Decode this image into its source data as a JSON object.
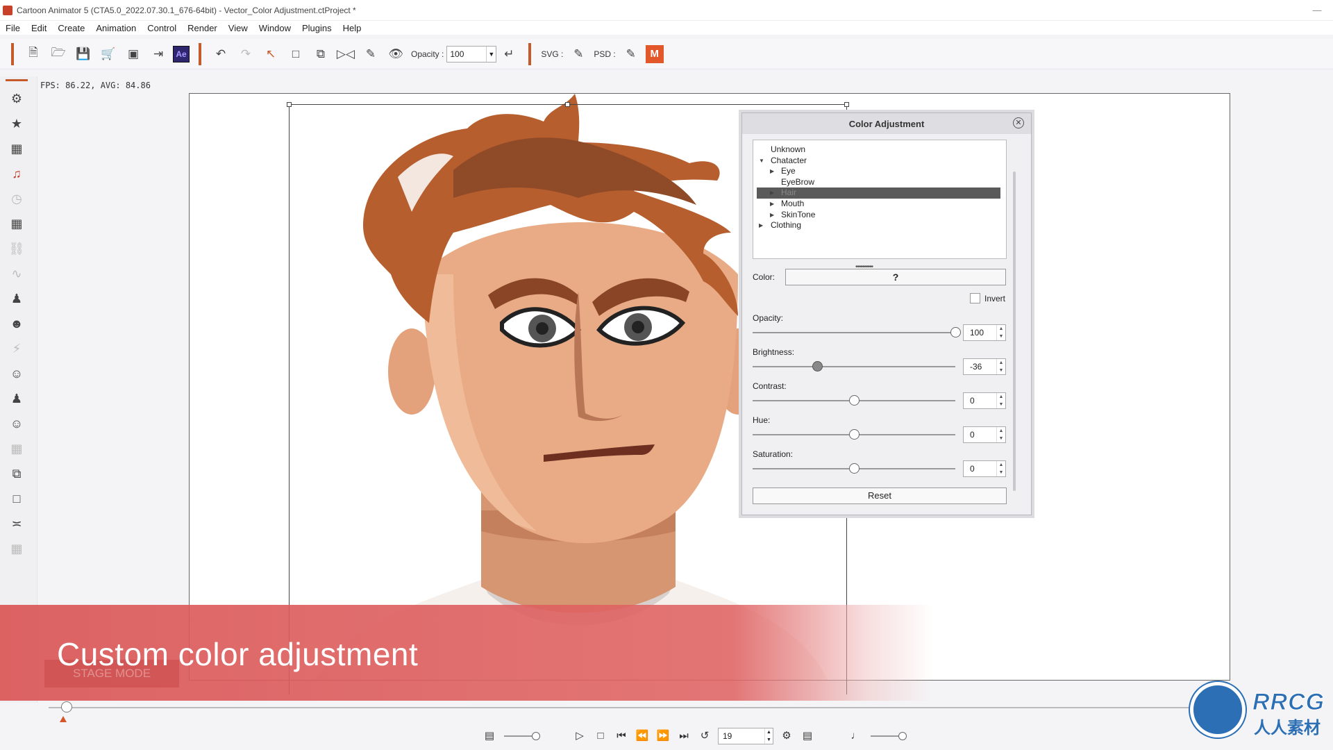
{
  "window": {
    "title": "Cartoon Animator 5  (CTA5.0_2022.07.30.1_676-64bit) - Vector_Color Adjustment.ctProject *",
    "minimize": "—"
  },
  "menu": [
    "File",
    "Edit",
    "Create",
    "Animation",
    "Control",
    "Render",
    "View",
    "Window",
    "Plugins",
    "Help"
  ],
  "toolbar": {
    "opacity_label": "Opacity :",
    "opacity_value": "100",
    "svg_label": "SVG :",
    "psd_label": "PSD :",
    "ae_label": "Ae",
    "m_label": "M"
  },
  "status": {
    "fps": "FPS: 86.22, AVG: 84.86"
  },
  "color_panel": {
    "title": "Color Adjustment",
    "tree": [
      {
        "label": "Unknown",
        "level": 1,
        "arrow": ""
      },
      {
        "label": "Chatacter",
        "level": 1,
        "arrow": "down"
      },
      {
        "label": "Eye",
        "level": 2,
        "arrow": "right"
      },
      {
        "label": "EyeBrow",
        "level": 2,
        "arrow": ""
      },
      {
        "label": "Hair",
        "level": 2,
        "arrow": "right",
        "selected": true
      },
      {
        "label": "Mouth",
        "level": 2,
        "arrow": "right"
      },
      {
        "label": "SkinTone",
        "level": 2,
        "arrow": "right"
      },
      {
        "label": "Clothing",
        "level": 1,
        "arrow": "right"
      }
    ],
    "color_label": "Color:",
    "color_value": "?",
    "invert_label": "Invert",
    "invert_checked": false,
    "sliders": [
      {
        "label": "Opacity:",
        "value": "100",
        "fraction": 1.0
      },
      {
        "label": "Brightness:",
        "value": "-36",
        "fraction": 0.32
      },
      {
        "label": "Contrast:",
        "value": "0",
        "fraction": 0.5
      },
      {
        "label": "Hue:",
        "value": "0",
        "fraction": 0.5
      },
      {
        "label": "Saturation:",
        "value": "0",
        "fraction": 0.5
      }
    ],
    "reset_label": "Reset"
  },
  "caption": {
    "text": "Custom color adjustment",
    "stage_mode": "STAGE MODE"
  },
  "playback": {
    "frame": "19"
  },
  "watermark": {
    "line1": "RRCG",
    "line2": "人人素材"
  },
  "colors": {
    "accent": "#c55a2a",
    "banner": "#da5656",
    "hair": "#b85e2c",
    "skin": "#e8a882"
  }
}
